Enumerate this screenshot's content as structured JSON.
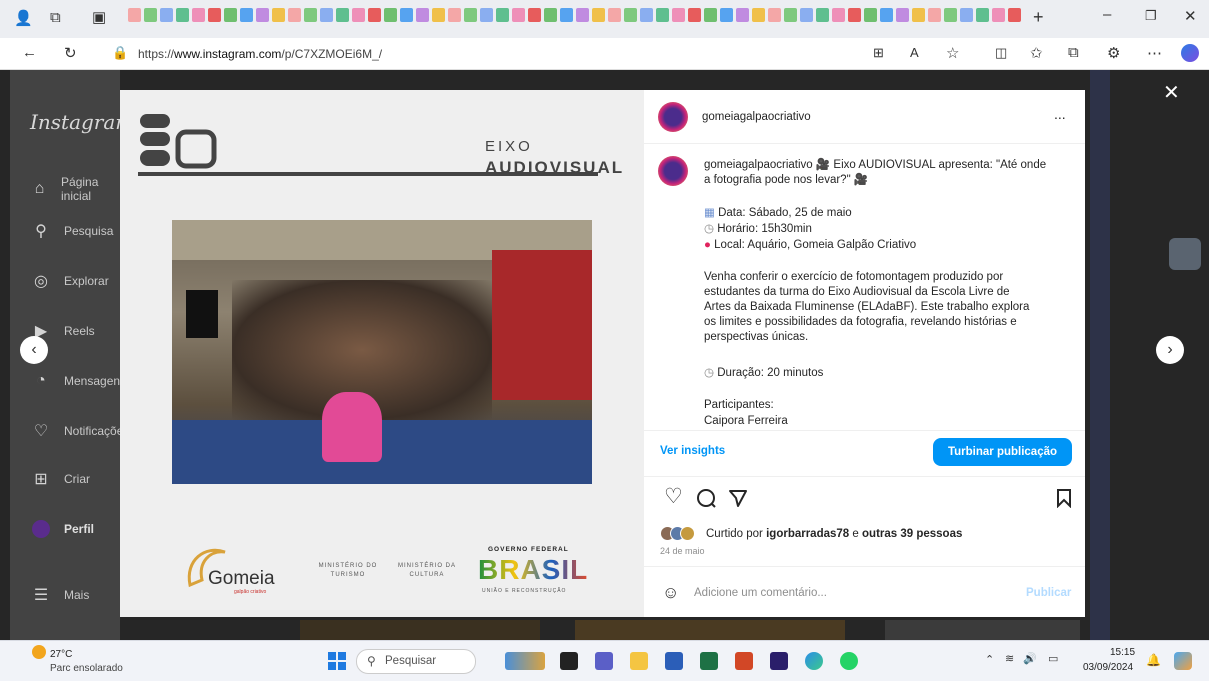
{
  "browser": {
    "url_prefix": "https://",
    "url_host": "www.instagram.com",
    "url_path": "/p/C7XZMOEi6M_/",
    "tab_colors": [
      "#f4a7a7",
      "#7ec97e",
      "#8aaef0",
      "#5fbf8f",
      "#ee8fb8",
      "#e75c5c",
      "#6fbf6f",
      "#56a3f0",
      "#c08be0",
      "#f0c04a"
    ]
  },
  "sidebar": {
    "brand": "Instagram",
    "items": [
      {
        "label": "Página inicial",
        "icon": "home-icon"
      },
      {
        "label": "Pesquisa",
        "icon": "search-icon"
      },
      {
        "label": "Explorar",
        "icon": "compass-icon"
      },
      {
        "label": "Reels",
        "icon": "reels-icon"
      },
      {
        "label": "Mensagens",
        "icon": "messenger-icon"
      },
      {
        "label": "Notificações",
        "icon": "heart-icon"
      },
      {
        "label": "Criar",
        "icon": "plus-square-icon"
      },
      {
        "label": "Perfil",
        "icon": "avatar-icon"
      },
      {
        "label": "Mais",
        "icon": "menu-icon"
      }
    ]
  },
  "post": {
    "header_user": "gomeiagalpaocriativo",
    "more": "...",
    "caption_user": "gomeiagalpaocriativo",
    "caption_intro": "Eixo AUDIOVISUAL apresenta: \"Até onde a fotografia pode nos levar?\"",
    "date": "Data: Sábado, 25 de maio",
    "time": "Horário: 15h30min",
    "place": "Local: Aquário, Gomeia Galpão Criativo",
    "body": "Venha conferir o exercício de fotomontagem produzido por estudantes da turma do Eixo Audiovisual da Escola Livre de Artes da Baixada Fluminense (ELAdaBF). Este trabalho explora os limites e possibilidades da fotografia, revelando histórias e perspectivas únicas.",
    "duration": "Duração: 20 minutos",
    "participants_label": "Participantes:",
    "participant_1": "Caipora Ferreira",
    "insights": "Ver insights",
    "boost": "Turbinar publicação",
    "liked_prefix": "Curtido por",
    "liked_user": "igorbarradas78",
    "liked_mid": "e",
    "liked_others": "outras 39 pessoas",
    "post_date": "24 de maio",
    "comment_placeholder": "Adicione um comentário...",
    "publish": "Publicar"
  },
  "artwork": {
    "eixo_line1": "EIXO",
    "eixo_line2": "AUDIOVISUAL",
    "logo_text": "Gomeia",
    "logo_sub": "galpão criativo",
    "min_turismo": "MINISTÉRIO DO TURISMO",
    "min_cultura": "MINISTÉRIO DA CULTURA",
    "gov_top": "GOVERNO FEDERAL",
    "gov_word": "BRASIL",
    "gov_bottom": "UNIÃO E RECONSTRUÇÃO"
  },
  "taskbar": {
    "temp": "27°C",
    "weather": "Parc ensolarado",
    "search": "Pesquisar",
    "time": "15:15",
    "date": "03/09/2024"
  }
}
